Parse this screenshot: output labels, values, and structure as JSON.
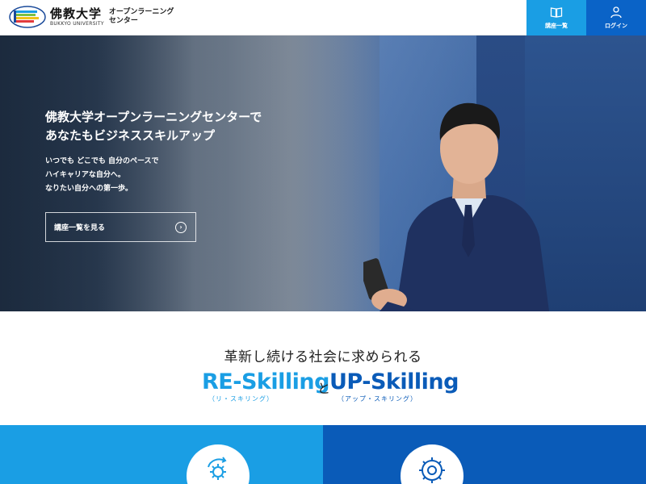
{
  "header": {
    "logo_ja": "佛教大学",
    "logo_en": "BUKKYO UNIVERSITY",
    "logo_sub_line1": "オープンラーニング",
    "logo_sub_line2": "センター",
    "nav": {
      "courses_label": "講座一覧",
      "courses_icon": "book-icon",
      "login_label": "ログイン",
      "login_icon": "user-icon"
    }
  },
  "hero": {
    "title_line1": "佛教大学オープンラーニングセンターで",
    "title_line2": "あなたもビジネススキルアップ",
    "desc_line1": "いつでも どこでも 自分のペースで",
    "desc_line2": "ハイキャリアな自分へ。",
    "desc_line3": "なりたい自分への第一歩。",
    "cta_label": "講座一覧を見る",
    "cta_icon": "chevron-right-circle-icon"
  },
  "section": {
    "title": "革新し続ける社会に求められる",
    "re_skilling": "RE-Skilling",
    "connector": "と",
    "up_skilling": "UP-Skilling",
    "re_kana": "（リ・スキリング）",
    "up_kana": "（アップ・スキリング）"
  },
  "panels": {
    "left_icon": "gear-refresh-icon",
    "right_icon": "gear-growth-icon"
  },
  "colors": {
    "light_blue": "#1a9ee4",
    "dark_blue": "#0a5bb8",
    "login_blue": "#0a63c7"
  }
}
